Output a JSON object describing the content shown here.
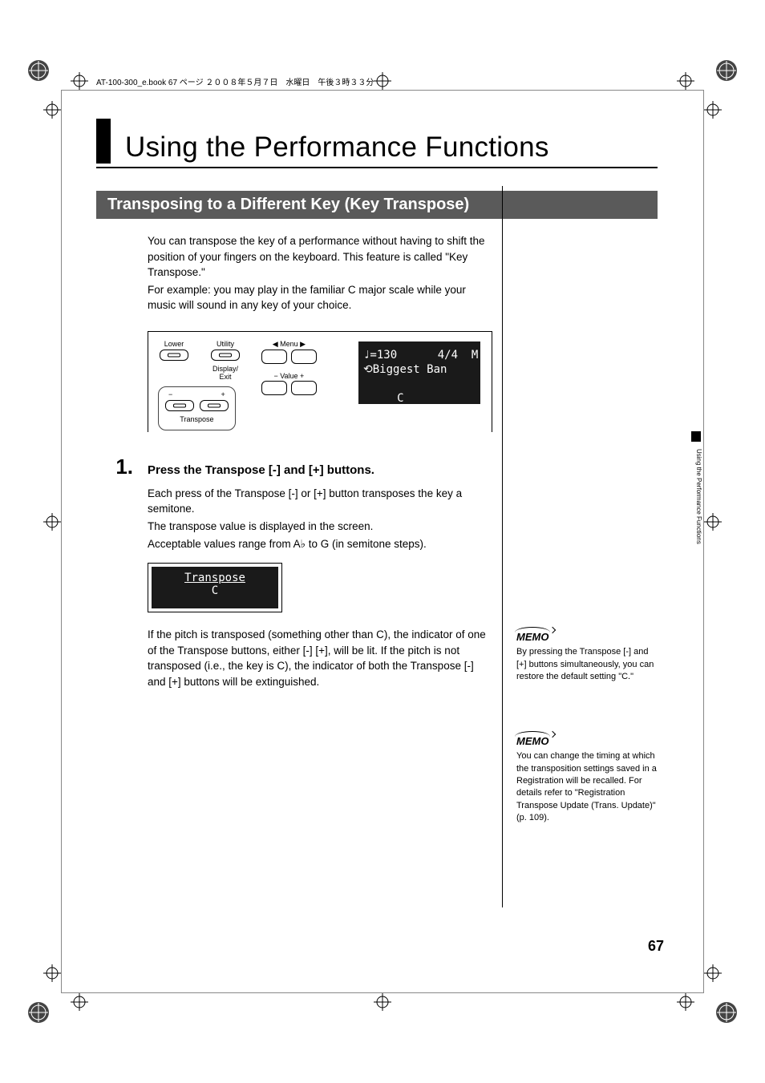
{
  "header": {
    "running_head": "AT-100-300_e.book  67 ページ  ２００８年５月７日　水曜日　午後３時３３分"
  },
  "title": "Using the Performance Functions",
  "section": {
    "heading": "Transposing to a Different Key (Key Transpose)",
    "intro_p1": "You can transpose the key of a performance without having to shift the position of your fingers on the keyboard. This feature is called \"Key Transpose.\"",
    "intro_p2": "For example: you may play in the familiar C major scale while your music will sound in any key of your choice."
  },
  "panel": {
    "lower_label": "Lower",
    "utility_label": "Utility",
    "menu_label": "◀ Menu ▶",
    "display_exit_label": "Display/\nExit",
    "value_label": "−  Value  +",
    "minus": "−",
    "plus": "+",
    "transpose_label": "Transpose",
    "lcd_line1": "♩=130      4/4  M:",
    "lcd_line2": "⟲Biggest Ban",
    "lcd_line3": "     C"
  },
  "step": {
    "number": "1.",
    "heading": "Press the Transpose [-] and [+] buttons.",
    "p1": "Each press of the Transpose [-] or [+] button transposes the key a semitone.",
    "p2": "The transpose value is displayed in the screen.",
    "p3": "Acceptable values range from A♭ to G (in semitone steps).",
    "lcd_small_line1": "Transpose",
    "lcd_small_line2": "C",
    "p4": "If the pitch is transposed (something other than C), the indicator of one of the Transpose buttons, either [-] [+], will be lit. If the pitch is not transposed (i.e., the key is C), the indicator of both the Transpose [-] and [+] buttons will be extinguished."
  },
  "memo1": {
    "label": "MEMO",
    "text": "By pressing the Transpose [-] and  [+] buttons simultaneously, you can restore the default setting \"C.\""
  },
  "memo2": {
    "label": "MEMO",
    "text": "You can change the timing at which the transposition settings saved in a Registration will be recalled. For details refer to \"Registration Transpose Update (Trans. Update)\" (p. 109)."
  },
  "side_tab_text": "Using the Performance Functions",
  "page_number": "67"
}
